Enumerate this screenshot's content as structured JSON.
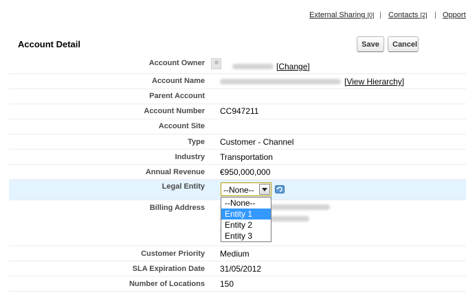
{
  "top_links": {
    "external_sharing": {
      "label": "External Sharing",
      "count": "[0]"
    },
    "contacts": {
      "label": "Contacts",
      "count": "[2]"
    },
    "opportunities": {
      "label": "Opport"
    },
    "separator": "|"
  },
  "header": {
    "title": "Account Detail",
    "save_label": "Save",
    "cancel_label": "Cancel"
  },
  "fields": {
    "account_owner": {
      "label": "Account Owner",
      "change_link": "[Change]"
    },
    "account_name": {
      "label": "Account Name",
      "hierarchy_link": "[View Hierarchy]"
    },
    "parent_account": {
      "label": "Parent Account",
      "value": ""
    },
    "account_number": {
      "label": "Account Number",
      "value": "CC947211"
    },
    "account_site": {
      "label": "Account Site",
      "value": ""
    },
    "type": {
      "label": "Type",
      "value": "Customer - Channel"
    },
    "industry": {
      "label": "Industry",
      "value": "Transportation"
    },
    "annual_revenue": {
      "label": "Annual Revenue",
      "value": "€950,000,000"
    },
    "legal_entity": {
      "label": "Legal Entity",
      "selected": "--None--",
      "options": [
        "--None--",
        "Entity 1",
        "Entity 2",
        "Entity 3"
      ],
      "highlighted": "Entity 1"
    },
    "billing_address": {
      "label": "Billing Address"
    },
    "customer_priority": {
      "label": "Customer Priority",
      "value": "Medium"
    },
    "sla_expiration_date": {
      "label": "SLA Expiration Date",
      "value": "31/05/2012"
    },
    "number_of_locations": {
      "label": "Number of Locations",
      "value": "150"
    }
  },
  "colors": {
    "highlight_row": "#e3f3ff",
    "selected_option": "#3399ff"
  }
}
